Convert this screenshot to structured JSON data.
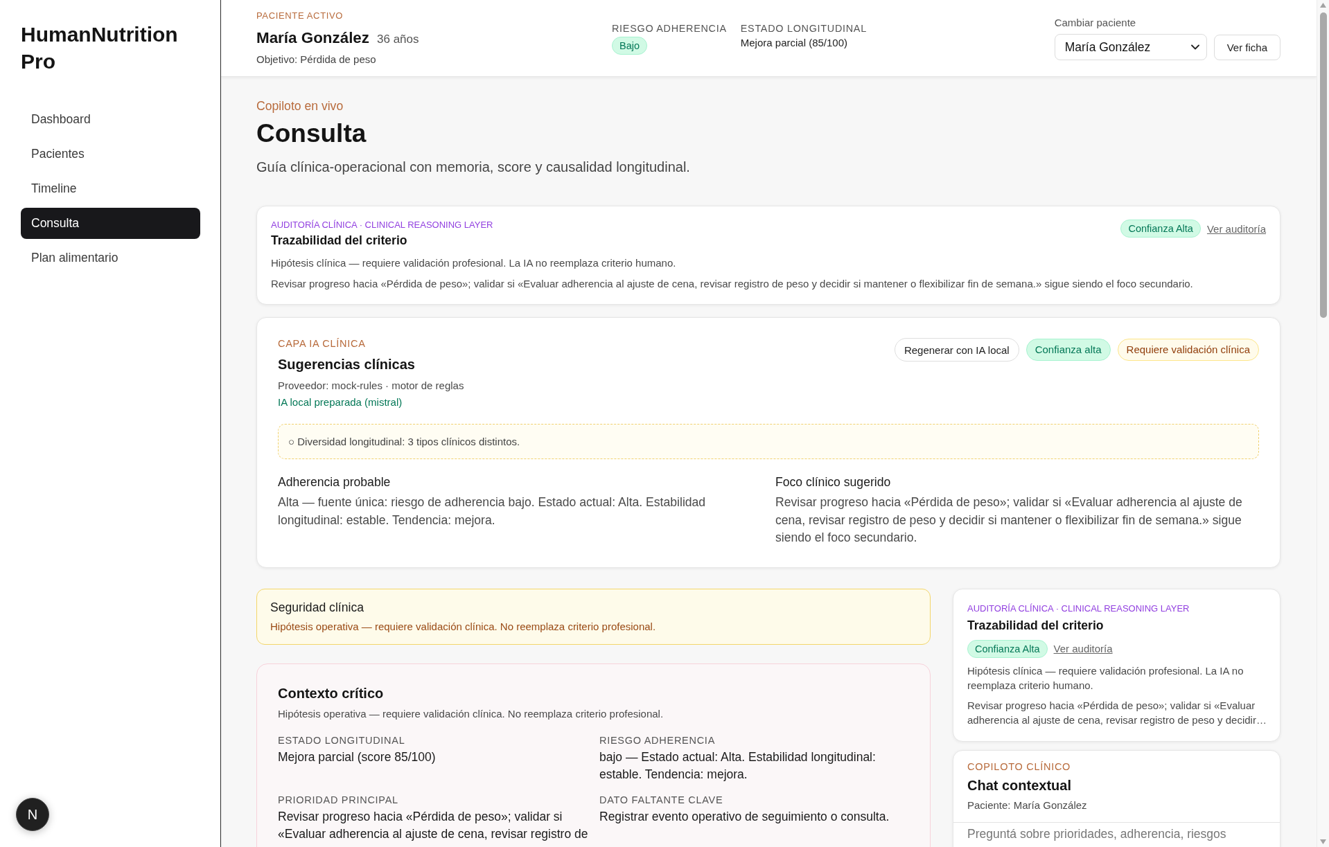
{
  "sidebar": {
    "brand": "HumanNutrition Pro",
    "nav": [
      {
        "label": "Dashboard",
        "selected": false
      },
      {
        "label": "Pacientes",
        "selected": false
      },
      {
        "label": "Timeline",
        "selected": false
      },
      {
        "label": "Consulta",
        "selected": true
      },
      {
        "label": "Plan alimentario",
        "selected": false
      }
    ],
    "indicator": "N"
  },
  "header": {
    "eyebrow": "PACIENTE ACTIVO",
    "patient_name": "María González",
    "age": "36 años",
    "goal": "Objetivo: Pérdida de peso",
    "metrics": [
      {
        "label": "RIESGO ADHERENCIA",
        "kind": "badge",
        "value": "Bajo"
      },
      {
        "label": "ESTADO LONGITUDINAL",
        "kind": "text",
        "value": "Mejora parcial (85/100)"
      }
    ],
    "switcher": {
      "label": "Cambiar paciente",
      "value": "María González"
    },
    "button": "Ver ficha"
  },
  "page": {
    "eyebrow": "Copiloto en vivo",
    "title": "Consulta",
    "subtitle": "Guía clínica-operacional con memoria, score y causalidad longitudinal."
  },
  "audit_card": {
    "eyebrow": "AUDITORÍA CLÍNICA · CLINICAL REASONING LAYER",
    "title": "Trazabilidad del criterio",
    "badge": "Confianza Alta",
    "link": "Ver auditoría",
    "lines": [
      "Hipótesis clínica — requiere validación profesional. La IA no reemplaza criterio humano.",
      "Revisar progreso hacia «Pérdida de peso»; validar si «Evaluar adherencia al ajuste de cena, revisar registro de peso y decidir si mantener o flexibilizar fin de semana.» sigue siendo el foco secundario."
    ]
  },
  "suggestions": {
    "eyebrow": "CAPA IA CLÍNICA",
    "title": "Sugerencias clínicas",
    "provider": "Proveedor: mock-rules · motor de reglas",
    "status": "IA local preparada (mistral)",
    "actions": [
      {
        "kind": "button",
        "label": "Regenerar con IA local"
      },
      {
        "kind": "success",
        "label": "Confianza alta"
      },
      {
        "kind": "warning",
        "label": "Requiere validación clínica"
      }
    ],
    "notice": "○ Diversidad longitudinal: 3 tipos clínicos distintos.",
    "columns": [
      {
        "title": "Adherencia probable",
        "text": "Alta — fuente única: riesgo de adherencia bajo. Estado actual: Alta. Estabilidad longitudinal: estable. Tendencia: mejora."
      },
      {
        "title": "Foco clínico sugerido",
        "text": "Revisar progreso hacia «Pérdida de peso»; validar si «Evaluar adherencia al ajuste de cena, revisar registro de peso y decidir si mantener o flexibilizar fin de semana.» sigue siendo el foco secundario."
      }
    ]
  },
  "safety": {
    "title": "Seguridad clínica",
    "text": "Hipótesis operativa — requiere validación clínica. No reemplaza criterio profesional."
  },
  "critical_context": {
    "title": "Contexto crítico",
    "subtitle": "Hipótesis operativa — requiere validación clínica. No reemplaza criterio profesional.",
    "fields": [
      {
        "label": "ESTADO LONGITUDINAL",
        "value": "Mejora parcial (score 85/100)"
      },
      {
        "label": "RIESGO ADHERENCIA",
        "value": "bajo — Estado actual: Alta. Estabilidad longitudinal: estable. Tendencia: mejora."
      },
      {
        "label": "PRIORIDAD PRINCIPAL",
        "value": "Revisar progreso hacia «Pérdida de peso»; validar si «Evaluar adherencia al ajuste de cena, revisar registro de"
      },
      {
        "label": "DATO FALTANTE CLAVE",
        "value": "Registrar evento operativo de seguimiento o consulta."
      }
    ]
  },
  "side_audit": {
    "eyebrow": "AUDITORÍA CLÍNICA · CLINICAL REASONING LAYER",
    "title": "Trazabilidad del criterio",
    "badge": "Confianza Alta",
    "link": "Ver auditoría",
    "lines": [
      "Hipótesis clínica — requiere validación profesional. La IA no reemplaza criterio humano.",
      "Revisar progreso hacia «Pérdida de peso»; validar si «Evaluar adherencia al ajuste de cena, revisar registro de peso y decidir…"
    ]
  },
  "chat": {
    "eyebrow": "COPILOTO CLÍNICO",
    "title": "Chat contextual",
    "patient": "Paciente: María González",
    "placeholder": "Preguntá sobre prioridades, adherencia, riesgos"
  }
}
